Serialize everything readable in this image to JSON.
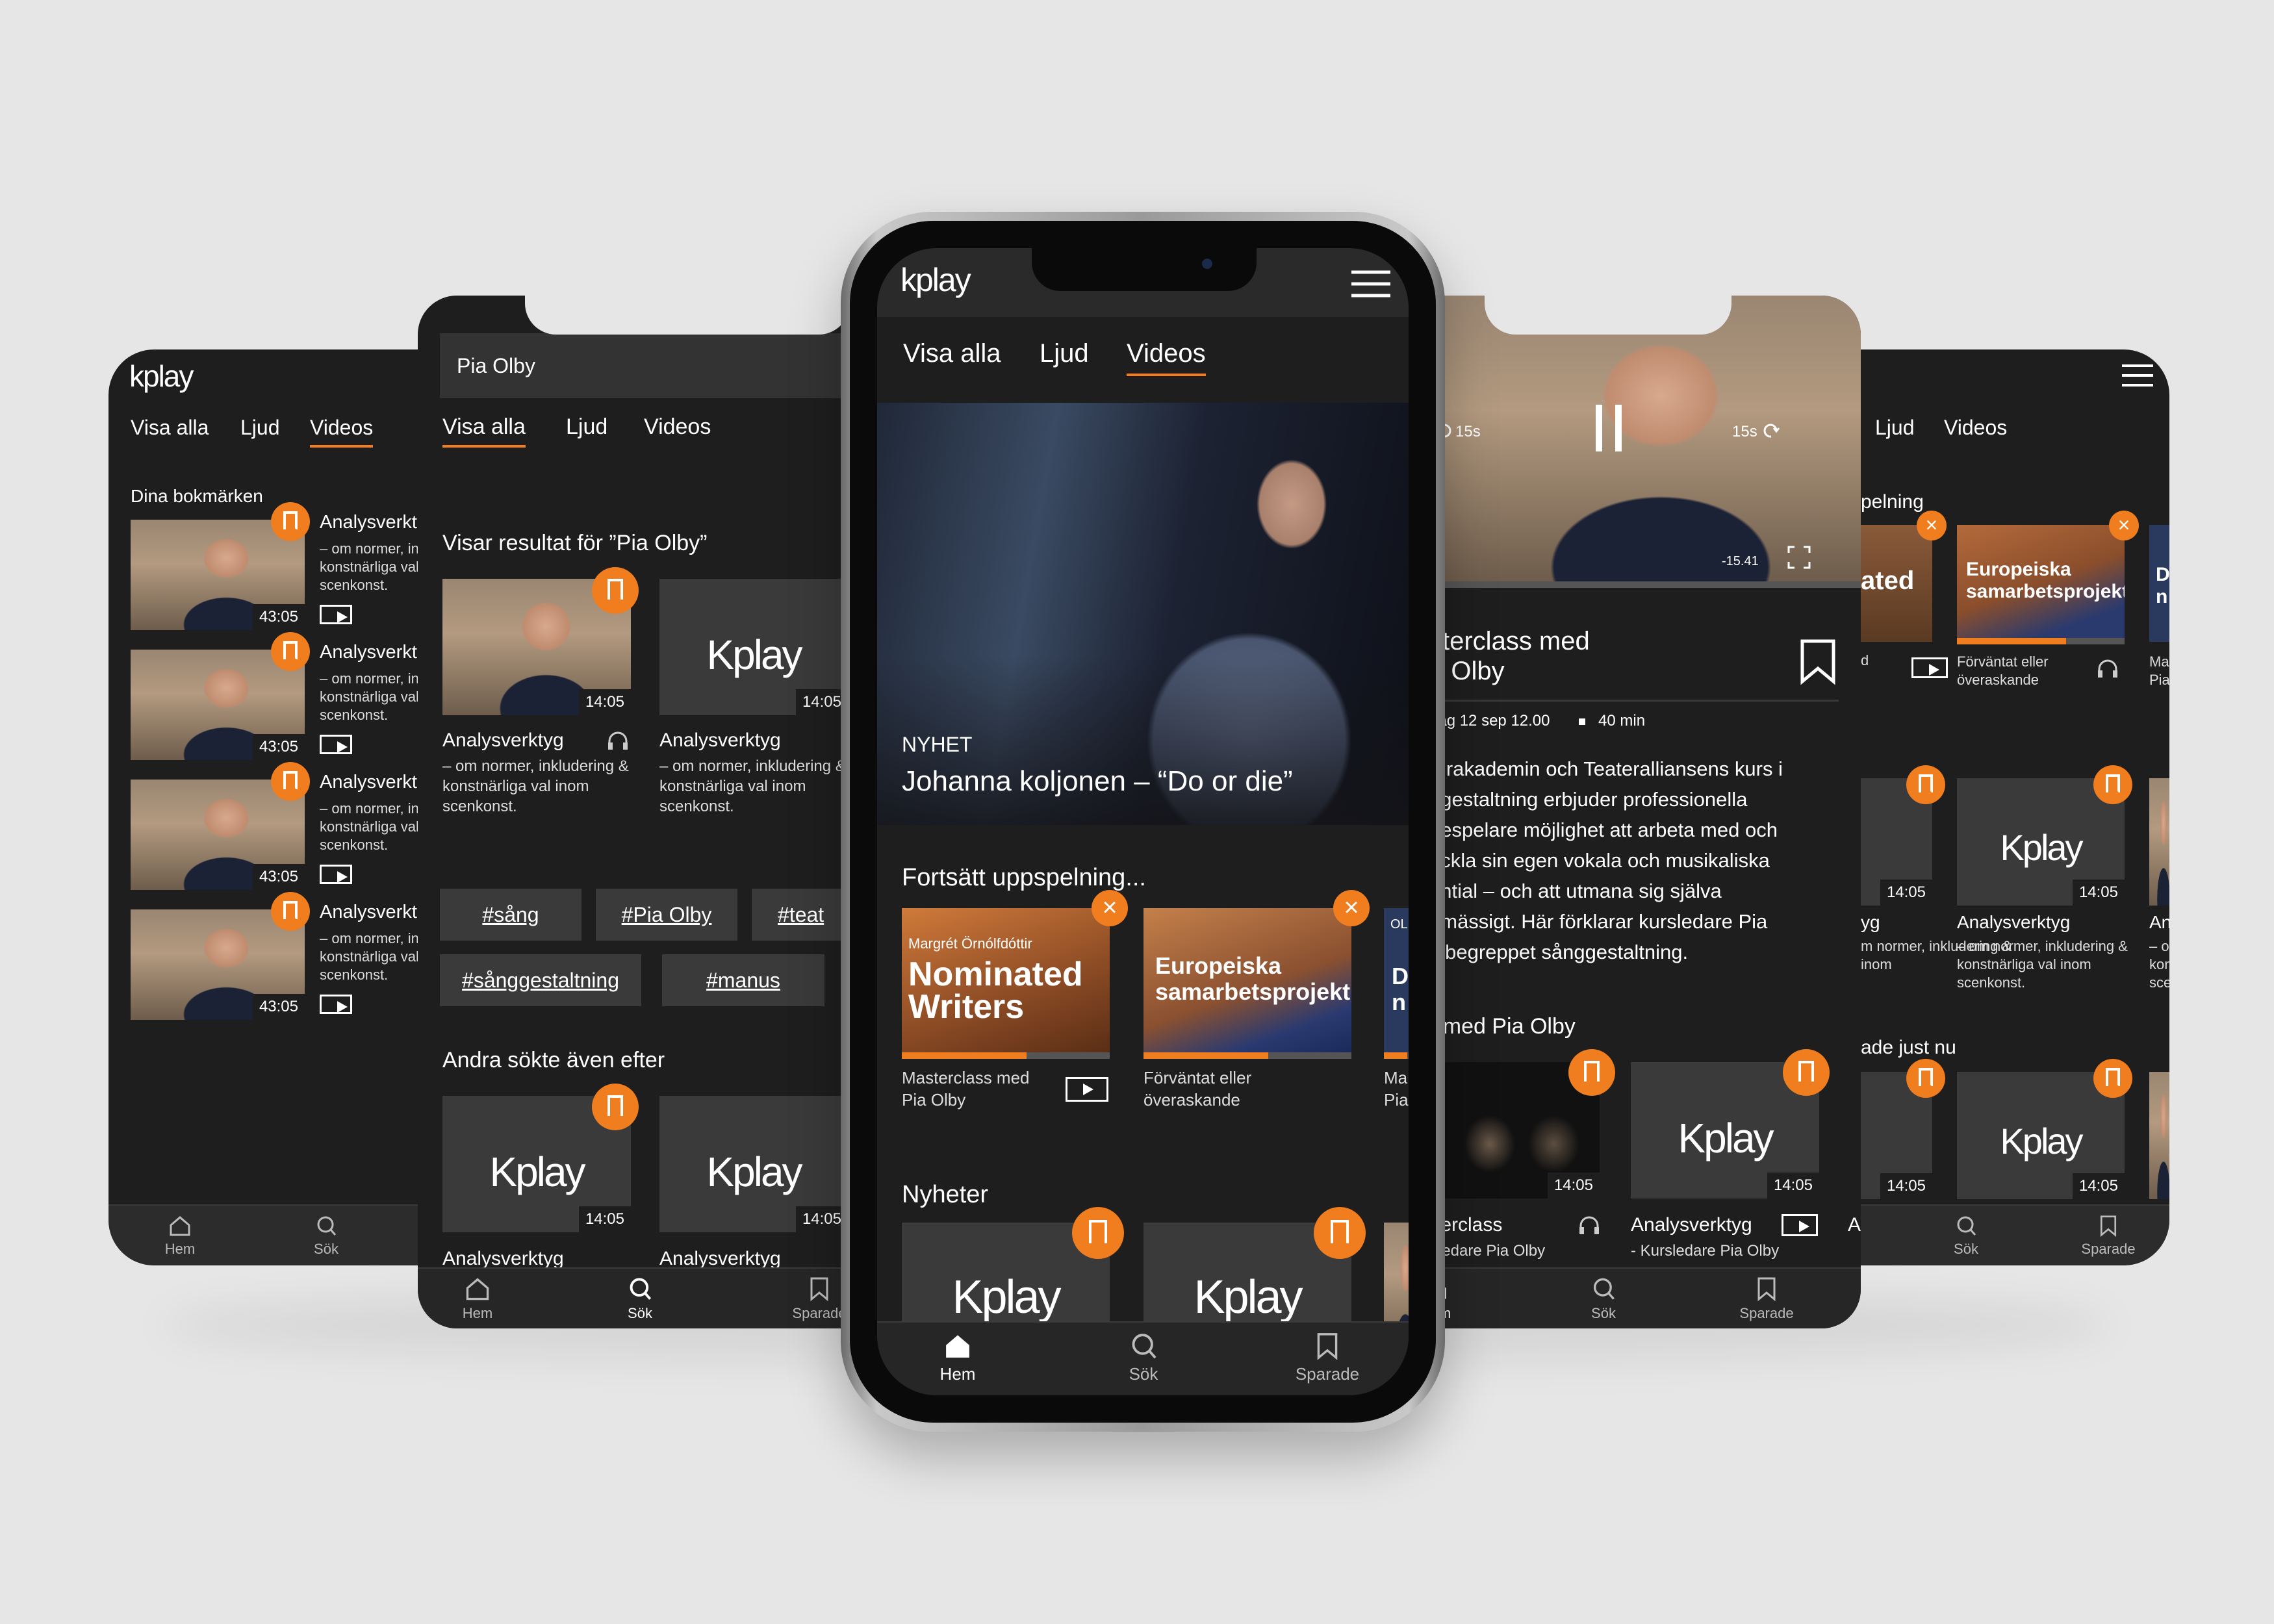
{
  "brand": {
    "logo": "kplay",
    "logo_alt": "Kplay",
    "accent": "#f07d1e",
    "background": "#1e1e1e"
  },
  "tabs": {
    "all": "Visa alla",
    "audio": "Ljud",
    "video": "Videos"
  },
  "nav": {
    "home": "Hem",
    "search": "Sök",
    "saved": "Sparade"
  },
  "screen1": {
    "section_title": "Dina bokmärken",
    "items": [
      {
        "title": "Analysverkt",
        "desc1": "– om normer, ink",
        "desc2": "konstnärliga val",
        "desc3": "scenkonst.",
        "duration": "43:05"
      },
      {
        "title": "Analysverkt",
        "desc1": "– om normer, in",
        "desc2": "konstnärliga val",
        "desc3": "scenkonst.",
        "duration": "43:05"
      },
      {
        "title": "Analysverkt",
        "desc1": "– om normer, ink",
        "desc2": "konstnärliga val",
        "desc3": "scenkonst.",
        "duration": "43:05"
      },
      {
        "title": "Analysverkt",
        "desc1": "– om normer, ink",
        "desc2": "konstnärliga val",
        "desc3": "scenkonst.",
        "duration": "43:05"
      }
    ]
  },
  "screen2": {
    "search_value": "Pia Olby",
    "results_heading": "Visar resultat för ”Pia Olby”",
    "results": [
      {
        "title": "Analysverktyg",
        "desc1": "– om normer, inkludering &",
        "desc2": "konstnärliga val inom",
        "desc3": "scenkonst.",
        "duration": "14:05"
      },
      {
        "title": "Analysverktyg",
        "desc1": "– om normer, inkludering &",
        "desc2": "konstnärliga val inom",
        "desc3": "scenkonst.",
        "duration": "14:05"
      }
    ],
    "tags": [
      "#sång",
      "#Pia Olby",
      "#teat",
      "#sånggestaltning",
      "#manus"
    ],
    "also_searched": "Andra sökte även efter",
    "also": [
      {
        "title": "Analysverktyg",
        "duration": "14:05"
      },
      {
        "title": "Analysverktyg",
        "duration": "14:05"
      }
    ]
  },
  "screen3": {
    "hero_kicker": "NYHET",
    "hero_title": "Johanna koljonen – “Do or die”",
    "continue_heading": "Fortsätt uppspelning...",
    "continue": [
      {
        "overlay_small": "Margrét Örnólfdóttir",
        "overlay_big1": "Nominated",
        "overlay_big2": "Writers",
        "label1": "Masterclass med",
        "label2": "Pia Olby",
        "progress": 0.6
      },
      {
        "overlay_big1": "Europeiska",
        "overlay_big2": "samarbetsprojekt",
        "label1": "Förväntat eller",
        "label2": "överaskande",
        "progress": 0.6
      },
      {
        "overlay_small": "OL",
        "overlay_big1": "D",
        "overlay_big2": "n",
        "label1": "Ma",
        "label2": "Pia"
      }
    ],
    "news_heading": "Nyheter"
  },
  "screen4": {
    "skip_back": "15s",
    "skip_fwd": "15s",
    "remaining": "-15.41",
    "progress": 0.0,
    "title1": "sterclass med",
    "title2": "a Olby",
    "meta_date": "dag 12 sep 12.00",
    "meta_length": "40 min",
    "body": [
      "turakademin och Teateralliansens kurs i",
      "ggestaltning erbjuder professionella",
      "despelare möjlighet att arbeta med och",
      "eckla sin egen vokala och musikaliska",
      "ential – och att utmana sig själva",
      "gmässigt. Här förklarar kursledare Pia",
      "y begreppet sånggestaltning."
    ],
    "more_heading": "r med Pia Olby",
    "more": [
      {
        "title": "sterclass",
        "sub": "rsledare Pia Olby",
        "duration": "14:05"
      },
      {
        "title": "Analysverktyg",
        "sub": "- Kursledare Pia Olby",
        "duration": "14:05"
      }
    ],
    "more_third": "A"
  },
  "screen5": {
    "continue_heading": "pelning",
    "cards": [
      {
        "overlay": "ated",
        "label": "d"
      },
      {
        "overlay1": "Europeiska",
        "overlay2": "samarbetsprojekt",
        "label1": "Förväntat eller",
        "label2": "överaskande",
        "progress": 0.65
      },
      {
        "overlay1": "D",
        "overlay2": "n",
        "label1": "Ma",
        "label2": "Pia"
      }
    ],
    "row2": [
      {
        "title": "yg",
        "sub1": "m normer, inkludering &",
        "sub2": "inom",
        "duration": "14:05"
      },
      {
        "title": "Analysverktyg",
        "sub1": "– om normer, inkludering &",
        "sub2": "konstnärliga val inom",
        "sub3": "scenkonst.",
        "duration": "14:05"
      },
      {
        "title": "An",
        "sub1": "– o",
        "sub2": "kon",
        "sub3": "sce"
      }
    ],
    "trending_heading": "ade just nu",
    "row3_durations": [
      "14:05",
      "14:05"
    ]
  }
}
